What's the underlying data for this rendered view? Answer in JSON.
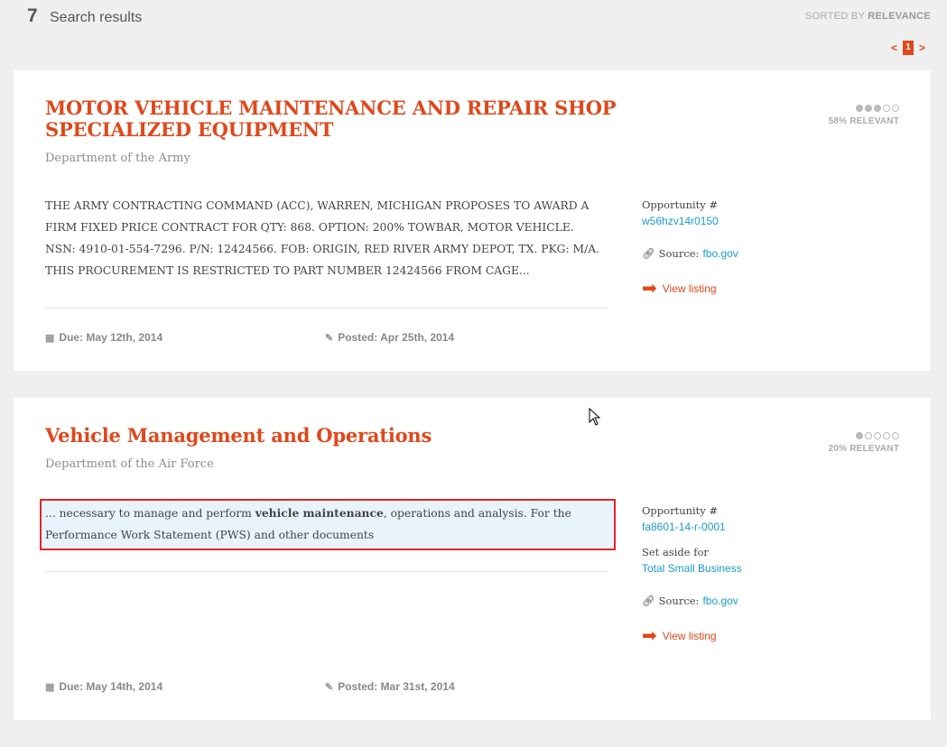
{
  "header": {
    "count": "7",
    "label": "Search results",
    "sorted_prefix": "SORTED BY",
    "sorted_value": "RELEVANCE"
  },
  "pagination": {
    "prev": "<",
    "current": "1",
    "next": ">"
  },
  "results": [
    {
      "title": "MOTOR VEHICLE MAINTENANCE AND REPAIR SHOP SPECIALIZED EQUIPMENT",
      "agency": "Department of the Army",
      "description": "THE ARMY CONTRACTING COMMAND (ACC), WARREN, MICHIGAN PROPOSES TO AWARD A FIRM FIXED PRICE CONTRACT FOR QTY: 868. OPTION: 200% TOWBAR, MOTOR VEHICLE. NSN: 4910-01-554-7296. P/N: 12424566. FOB: ORIGIN, RED RIVER ARMY DEPOT, TX. PKG: M/A. THIS PROCUREMENT IS RESTRICTED TO PART NUMBER 12424566 FROM CAGE...",
      "relevance_text": "58% RELEVANT",
      "relevance_dots": 3,
      "opportunity_label": "Opportunity #",
      "opportunity_id": "w56hzv14r0150",
      "source_label": "Source:",
      "source": "fbo.gov",
      "view_label": "View listing",
      "due": "Due: May 12th, 2014",
      "posted": "Posted: Apr 25th, 2014"
    },
    {
      "title": "Vehicle Management and Operations",
      "agency": "Department of the Air Force",
      "description_pre": "... necessary to manage and perform ",
      "description_bold": "vehicle maintenance",
      "description_post": ", operations and analysis. For the Performance Work Statement (PWS) and other documents",
      "relevance_text": "20% RELEVANT",
      "relevance_dots": 1,
      "opportunity_label": "Opportunity #",
      "opportunity_id": "fa8601-14-r-0001",
      "setaside_label": "Set aside for",
      "setaside": "Total Small Business",
      "source_label": "Source:",
      "source": "fbo.gov",
      "view_label": "View listing",
      "due": "Due: May 14th, 2014",
      "posted": "Posted: Mar 31st, 2014"
    }
  ],
  "colors": {
    "accent": "#e0481c",
    "link": "#1a9bd0",
    "highlight_border": "#e0262a",
    "highlight_bg": "#e8f3fb"
  },
  "icons": [
    "calendar-icon",
    "pin-icon",
    "link-icon",
    "arrow-right-icon",
    "cursor-icon"
  ]
}
